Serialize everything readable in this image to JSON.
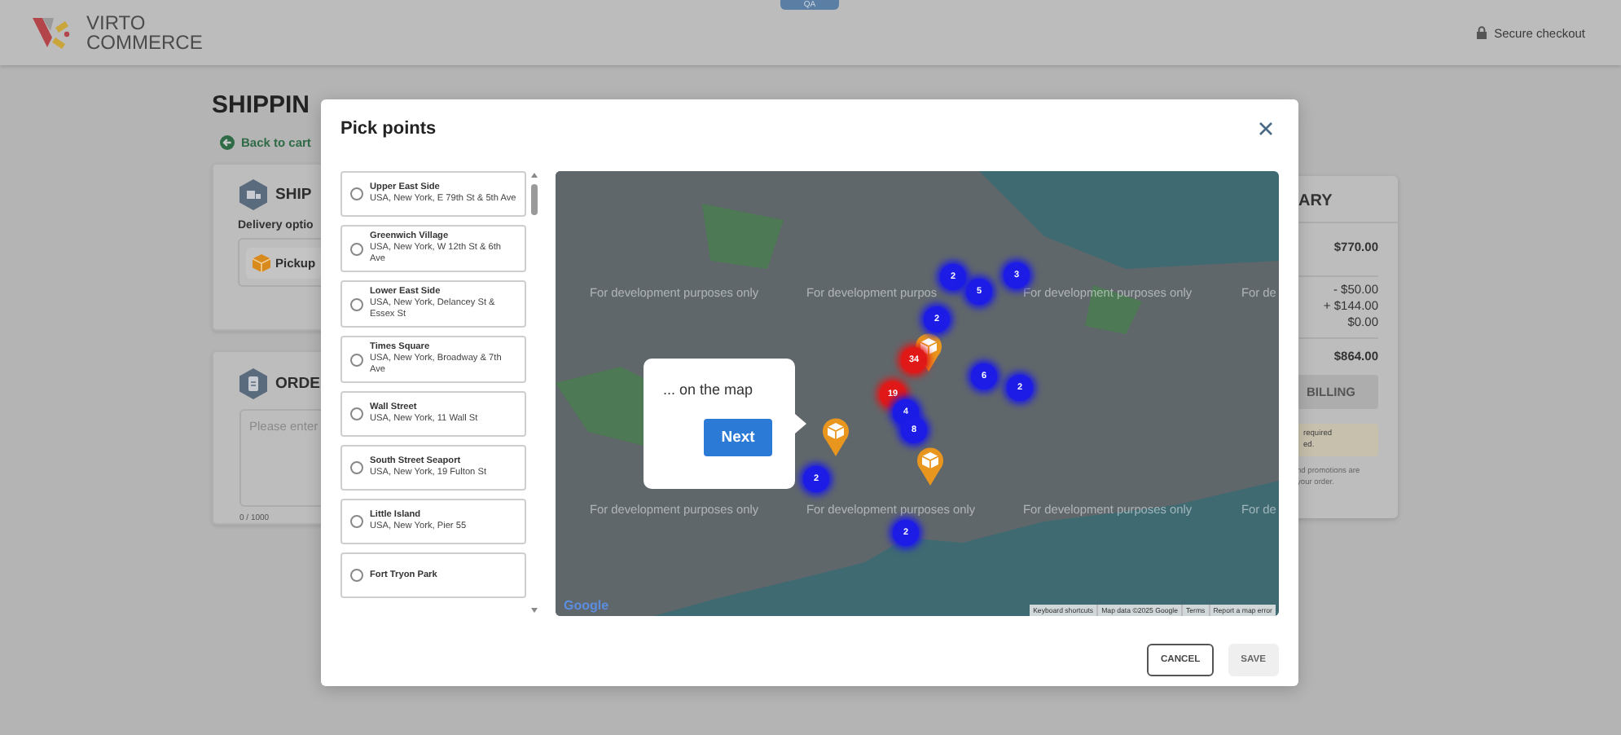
{
  "header": {
    "logo_line_1": "VIRTO",
    "logo_line_2": "COMMERCE",
    "env_badge": "QA",
    "secure_checkout": "Secure checkout"
  },
  "page": {
    "title": "SHIPPIN",
    "back_link": "Back to cart",
    "shipping_card": {
      "heading": "SHIP",
      "delivery_label": "Delivery optio",
      "option": "Pickup"
    },
    "order_card": {
      "heading": "ORDE",
      "comment_placeholder": "Please enter",
      "counter": "0 / 1000"
    }
  },
  "summary": {
    "heading": "ARY",
    "subtotal": "$770.00",
    "adjustments": [
      "- $50.00",
      "+ $144.00",
      "$0.00"
    ],
    "total": "$864.00",
    "button": "BILLING",
    "notice_lines": [
      "required",
      "ed."
    ],
    "note_lines": [
      "nd promotions are",
      "your order."
    ]
  },
  "modal": {
    "title": "Pick points",
    "points": [
      {
        "name": "Upper East Side",
        "address": "USA, New York, E 79th St & 5th Ave",
        "selected": false
      },
      {
        "name": "Greenwich Village",
        "address": "USA, New York, W 12th St & 6th Ave",
        "selected": false
      },
      {
        "name": "Lower East Side",
        "address": "USA, New York, Delancey St & Essex St",
        "selected": false
      },
      {
        "name": "Times Square",
        "address": "USA, New York, Broadway & 7th Ave",
        "selected": false
      },
      {
        "name": "Wall Street",
        "address": "USA, New York, 11 Wall St",
        "selected": false
      },
      {
        "name": "South Street Seaport",
        "address": "USA, New York, 19 Fulton St",
        "selected": false
      },
      {
        "name": "Little Island",
        "address": "USA, New York, Pier 55",
        "selected": false
      },
      {
        "name": "Fort Tryon Park",
        "selected": false
      }
    ],
    "map": {
      "watermarks": [
        "For development purposes only",
        "For development purpos",
        "For development purposes only",
        "For de",
        "For development purposes only",
        "For development purposes only",
        "For development purposes only",
        "For de"
      ],
      "clusters": [
        {
          "count": "2",
          "color": "#1c1ce6"
        },
        {
          "count": "5",
          "color": "#1c1ce6"
        },
        {
          "count": "3",
          "color": "#1c1ce6"
        },
        {
          "count": "2",
          "color": "#1c1ce6"
        },
        {
          "count": "34",
          "color": "#e01818"
        },
        {
          "count": "19",
          "color": "#e01818"
        },
        {
          "count": "4",
          "color": "#1c1ce6"
        },
        {
          "count": "8",
          "color": "#1c1ce6"
        },
        {
          "count": "6",
          "color": "#1c1ce6"
        },
        {
          "count": "2",
          "color": "#1c1ce6"
        },
        {
          "count": "2",
          "color": "#1c1ce6"
        },
        {
          "count": "2",
          "color": "#1c1ce6"
        }
      ],
      "tour": {
        "text": "... on the map",
        "button": "Next"
      },
      "google_logo": "Google",
      "attribution": [
        "Keyboard shortcuts",
        "Map data ©2025 Google",
        "Terms",
        "Report a map error"
      ]
    },
    "buttons": [
      {
        "label": "CANCEL",
        "disabled": false
      },
      {
        "label": "SAVE",
        "disabled": true
      }
    ]
  }
}
